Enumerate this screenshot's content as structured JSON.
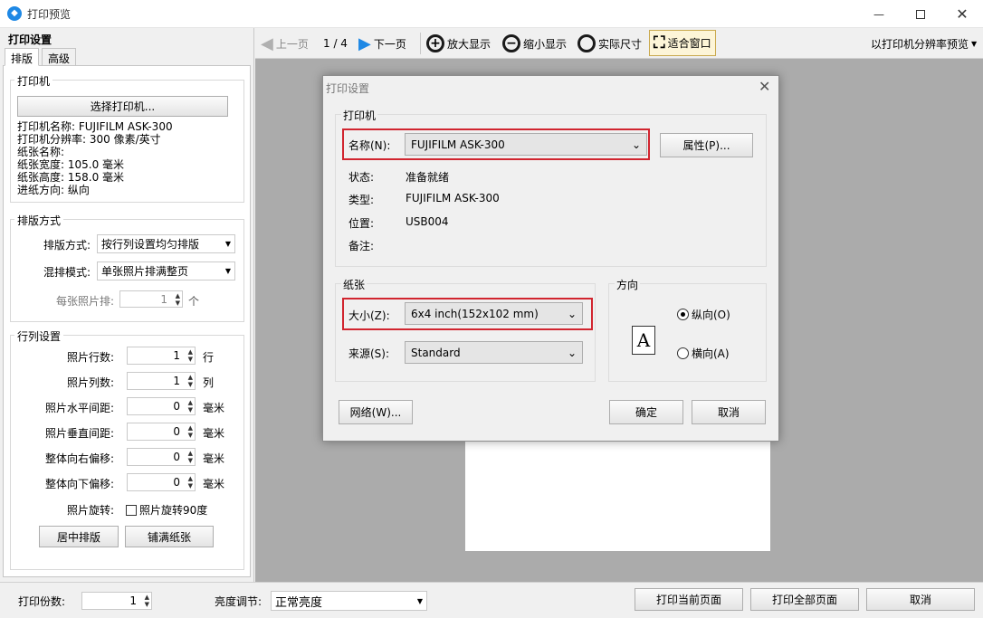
{
  "window": {
    "title": "打印预览",
    "app_icon": "app-logo-icon"
  },
  "left": {
    "header": "打印设置",
    "tabs": [
      "排版",
      "高级"
    ],
    "printer": {
      "group": "打印机",
      "select_button": "选择打印机...",
      "info": [
        "打印机名称: FUJIFILM ASK-300",
        "打印机分辨率: 300 像素/英寸",
        "纸张名称:",
        "纸张宽度: 105.0 毫米",
        "纸张高度: 158.0 毫米",
        "进纸方向: 纵向"
      ]
    },
    "layout": {
      "group": "排版方式",
      "mode_label": "排版方式:",
      "mode_value": "按行列设置均匀排版",
      "mix_label": "混排模式:",
      "mix_value": "单张照片排满整页",
      "per_label": "每张照片排:",
      "per_value": "1",
      "per_unit": "个"
    },
    "grid": {
      "group": "行列设置",
      "rows": [
        {
          "label": "照片行数:",
          "value": "1",
          "unit": "行"
        },
        {
          "label": "照片列数:",
          "value": "1",
          "unit": "列"
        },
        {
          "label": "照片水平间距:",
          "value": "0",
          "unit": "毫米"
        },
        {
          "label": "照片垂直间距:",
          "value": "0",
          "unit": "毫米"
        },
        {
          "label": "整体向右偏移:",
          "value": "0",
          "unit": "毫米"
        },
        {
          "label": "整体向下偏移:",
          "value": "0",
          "unit": "毫米"
        }
      ],
      "rotate_label": "照片旋转:",
      "rotate_check": "照片旋转90度",
      "center_button": "居中排版",
      "fill_button": "铺满纸张"
    }
  },
  "toolbar": {
    "prev": "上一页",
    "page": "1 / 4",
    "next": "下一页",
    "zoom_in": "放大显示",
    "zoom_out": "缩小显示",
    "actual": "实际尺寸",
    "fit": "适合窗口",
    "resolution": "以打印机分辨率预览"
  },
  "dialog": {
    "title": "打印设置",
    "printer_group": "打印机",
    "name_label": "名称(N):",
    "name_value": "FUJIFILM ASK-300",
    "props_button": "属性(P)...",
    "status_label": "状态:",
    "status_value": "准备就绪",
    "type_label": "类型:",
    "type_value": "FUJIFILM ASK-300",
    "where_label": "位置:",
    "where_value": "USB004",
    "comment_label": "备注:",
    "comment_value": "",
    "paper_group": "纸张",
    "size_label": "大小(Z):",
    "size_value": "6x4 inch(152x102 mm)",
    "source_label": "来源(S):",
    "source_value": "Standard",
    "orient_group": "方向",
    "portrait": "纵向(O)",
    "landscape": "横向(A)",
    "network_button": "网络(W)...",
    "ok_button": "确定",
    "cancel_button": "取消"
  },
  "bottom": {
    "copies_label": "打印份数:",
    "copies_value": "1",
    "brightness_label": "亮度调节:",
    "brightness_value": "正常亮度",
    "print_current": "打印当前页面",
    "print_all": "打印全部页面",
    "cancel": "取消"
  },
  "colors": {
    "accent": "#1e88e5",
    "highlight": "#d1252f",
    "preview_bg": "#ababab",
    "toolbar_icon": "#1a1a1a"
  }
}
